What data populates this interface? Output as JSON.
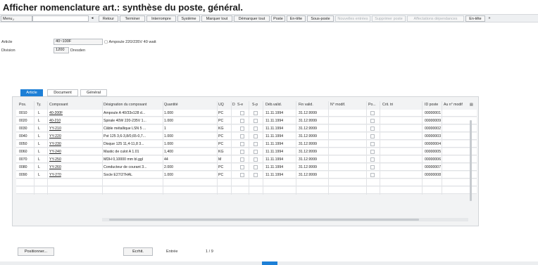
{
  "window": {
    "title": "Afficher nomenclature art.: synthèse du poste, général."
  },
  "toolbar": {
    "menu": "Menu",
    "items": [
      "Retour",
      "Terminer",
      "Interrompre",
      "Système",
      "Marquer tout",
      "Démarquer tout",
      "Poste",
      "En-tête",
      "Sous-poste",
      "Nouvelles entrées",
      "Supprimer poste",
      "Affectations dépendances",
      "En-tête"
    ],
    "disabled": [
      "Nouvelles entrées",
      "Supprimer poste",
      "Affectations dépendances"
    ],
    "overflow": "»"
  },
  "header": {
    "article_label": "Article",
    "article_value": "40~100F",
    "article_desc": "Ampoule 220/235V 40 watt",
    "division_label": "Division",
    "division_value": "1200",
    "division_desc": "Dresden"
  },
  "tabs": [
    {
      "label": "Article",
      "active": true
    },
    {
      "label": "Document",
      "active": false
    },
    {
      "label": "Général",
      "active": false
    }
  ],
  "table": {
    "columns": [
      "Pos.",
      "Ty.",
      "Composant",
      "Désignation du composant",
      "Quantité",
      "UQ",
      "D",
      "S-e",
      "S-p",
      "Déb.valid.",
      "Fin valid.",
      "N° modif.",
      "Po...",
      "Crit. tri",
      "ID poste",
      "Au n° modif"
    ],
    "rows": [
      {
        "pos": "0010",
        "ty": "L",
        "comp": "40-200F",
        "desc": "Ampoule A 40/33x128 d...",
        "qty": "1.000",
        "uq": "PC",
        "deb": "11.11.1994",
        "fin": "31.12.9999",
        "id": "00000001"
      },
      {
        "pos": "0020",
        "ty": "L",
        "comp": "40-210",
        "desc": "Spirale 40W 220-235V 1...",
        "qty": "1.000",
        "uq": "PC",
        "deb": "11.11.1994",
        "fin": "31.12.9999",
        "id": "00000009"
      },
      {
        "pos": "0030",
        "ty": "L",
        "comp": "YY-210",
        "desc": "Câble métallique LSN 5 ...",
        "qty": "1",
        "uq": "KG",
        "deb": "11.11.1994",
        "fin": "31.12.9999",
        "id": "00000002"
      },
      {
        "pos": "0040",
        "ty": "L",
        "comp": "YY-220",
        "desc": "Pst 125 3,6-3,8/0,65-0,7...",
        "qty": "1.000",
        "uq": "PC",
        "deb": "11.11.1994",
        "fin": "31.12.9999",
        "id": "00000003"
      },
      {
        "pos": "0050",
        "ty": "L",
        "comp": "YY-230",
        "desc": "Disque 125  11,4-11,8 3...",
        "qty": "1.000",
        "uq": "PC",
        "deb": "11.11.1994",
        "fin": "31.12.9999",
        "id": "00000004"
      },
      {
        "pos": "0060",
        "ty": "L",
        "comp": "YY-240",
        "desc": "Mastic de culot A 1.01",
        "qty": "1,400",
        "uq": "KG",
        "deb": "11.11.1994",
        "fin": "31.12.9999",
        "id": "00000005"
      },
      {
        "pos": "0070",
        "ty": "L",
        "comp": "YY-250",
        "desc": "MDH 0,10000 mm bl.ggl",
        "qty": "44",
        "uq": "M",
        "deb": "11.11.1994",
        "fin": "31.12.9999",
        "id": "00000006"
      },
      {
        "pos": "0080",
        "ty": "L",
        "comp": "YY-260",
        "desc": "Conducteur de courant 3...",
        "qty": "2.000",
        "uq": "PC",
        "deb": "11.11.1994",
        "fin": "31.12.9999",
        "id": "00000007"
      },
      {
        "pos": "0090",
        "ty": "L",
        "comp": "YY-270",
        "desc": "Socle E27/27HAL",
        "qty": "1.000",
        "uq": "PC",
        "deb": "11.11.1994",
        "fin": "31.12.9999",
        "id": "00000008"
      }
    ]
  },
  "footer": {
    "position_button": "Positionner...",
    "entry_label": "Ecrhit.",
    "entree_label": "Entrée",
    "counter": "1 / 9"
  },
  "colors": {
    "accent": "#1d7fd6",
    "toolbar_bg": "#eef0f2",
    "panel_bg": "#f2f3f4"
  }
}
